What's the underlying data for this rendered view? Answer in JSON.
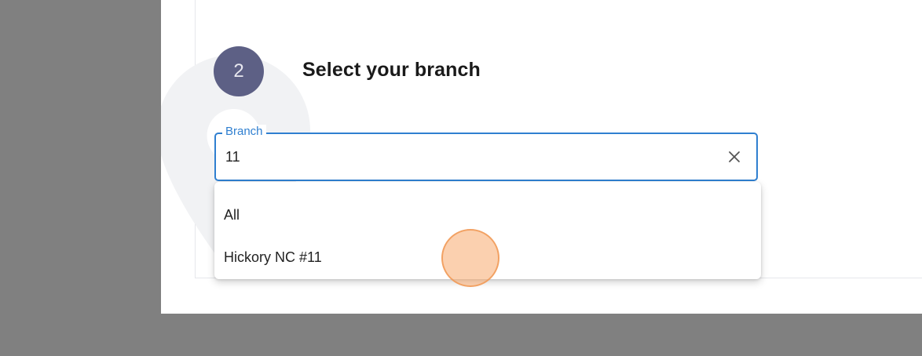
{
  "step": {
    "number": "2",
    "title": "Select your branch"
  },
  "branch_field": {
    "label": "Branch",
    "value": "11",
    "clear_icon": "close-icon"
  },
  "dropdown": {
    "options": [
      {
        "label": "All"
      },
      {
        "label": "Hickory NC #11"
      }
    ]
  },
  "decor": {
    "pin_icon": "map-pin-icon"
  },
  "colors": {
    "badge": "#5d6085",
    "accent": "#2f7fd0",
    "click_marker": "#f8aa6e"
  }
}
